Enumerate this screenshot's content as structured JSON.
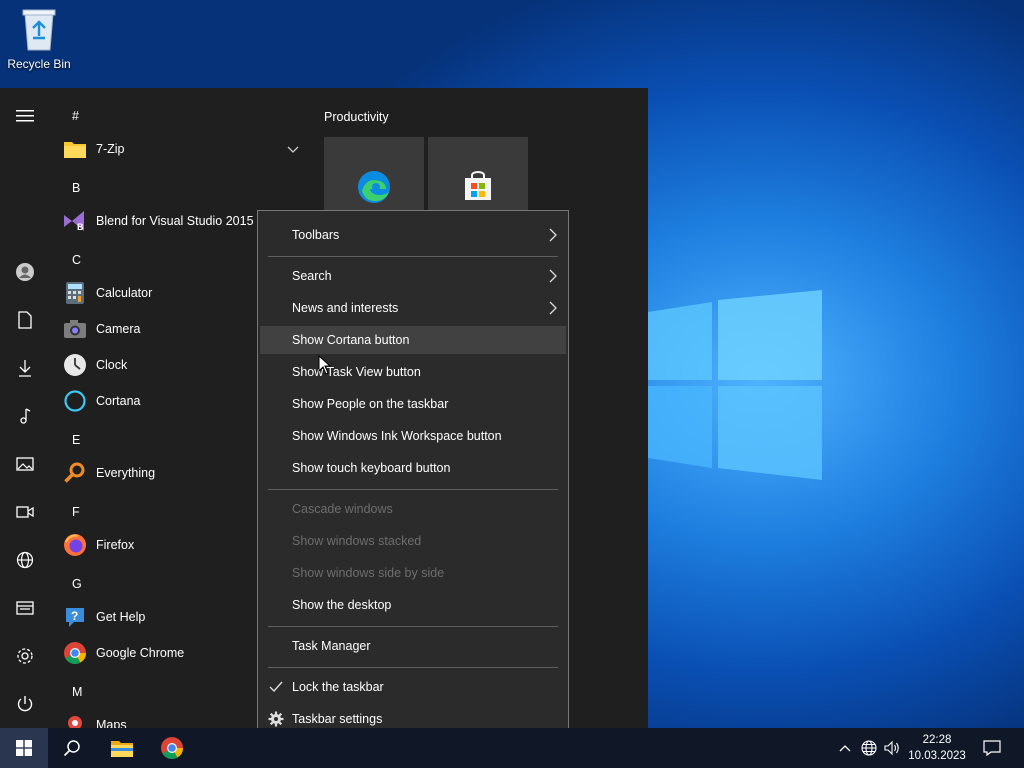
{
  "desktop": {
    "recycle_bin_label": "Recycle Bin"
  },
  "start_menu": {
    "rail_icons": [
      "hamburger-menu-icon",
      "user-icon",
      "documents-icon",
      "downloads-icon",
      "music-icon",
      "pictures-icon",
      "videos-icon",
      "network-icon",
      "file-explorer-icon",
      "settings-icon",
      "power-icon"
    ],
    "groups": [
      {
        "letter": "#",
        "apps": [
          {
            "name": "7-Zip",
            "icon": "folder-icon"
          }
        ]
      },
      {
        "letter": "B",
        "apps": [
          {
            "name": "Blend for Visual Studio 2015",
            "icon": "blend-icon"
          }
        ]
      },
      {
        "letter": "C",
        "apps": [
          {
            "name": "Calculator",
            "icon": "calculator-icon"
          },
          {
            "name": "Camera",
            "icon": "camera-icon"
          },
          {
            "name": "Clock",
            "icon": "clock-icon"
          },
          {
            "name": "Cortana",
            "icon": "cortana-icon"
          }
        ]
      },
      {
        "letter": "E",
        "apps": [
          {
            "name": "Everything",
            "icon": "search-magnifier-icon"
          }
        ]
      },
      {
        "letter": "F",
        "apps": [
          {
            "name": "Firefox",
            "icon": "firefox-icon"
          }
        ]
      },
      {
        "letter": "G",
        "apps": [
          {
            "name": "Get Help",
            "icon": "get-help-icon"
          },
          {
            "name": "Google Chrome",
            "icon": "chrome-icon"
          }
        ]
      },
      {
        "letter": "M",
        "apps": [
          {
            "name": "Maps",
            "icon": "maps-icon"
          }
        ]
      }
    ],
    "tiles_group_label": "Productivity",
    "tiles": [
      {
        "icon": "edge-icon"
      },
      {
        "icon": "store-icon"
      }
    ]
  },
  "context_menu": {
    "items": [
      {
        "label": "Toolbars",
        "submenu": true
      },
      {
        "label": "Search",
        "submenu": true
      },
      {
        "label": "News and interests",
        "submenu": true
      },
      {
        "label": "Show Cortana button",
        "hover": true
      },
      {
        "label": "Show Task View button"
      },
      {
        "label": "Show People on the taskbar"
      },
      {
        "label": "Show Windows Ink Workspace button"
      },
      {
        "label": "Show touch keyboard button"
      },
      {
        "label": "Cascade windows",
        "disabled": true
      },
      {
        "label": "Show windows stacked",
        "disabled": true
      },
      {
        "label": "Show windows side by side",
        "disabled": true
      },
      {
        "label": "Show the desktop"
      },
      {
        "label": "Task Manager"
      },
      {
        "label": "Lock the taskbar",
        "checked": true
      },
      {
        "label": "Taskbar settings",
        "icon": "gear-icon"
      }
    ]
  },
  "taskbar": {
    "pinned": [
      "start-windows-icon",
      "search-icon",
      "file-explorer-icon",
      "chrome-icon"
    ],
    "tray": [
      "chevron-up-icon",
      "network-globe-icon",
      "volume-icon"
    ],
    "time": "22:28",
    "date": "10.03.2023",
    "notification_icon": "action-center-icon"
  },
  "colors": {
    "start_bg": "#1f1f1f",
    "menu_bg": "#2b2b2b",
    "taskbar_bg": "#101828",
    "accent": "#0078d7"
  }
}
